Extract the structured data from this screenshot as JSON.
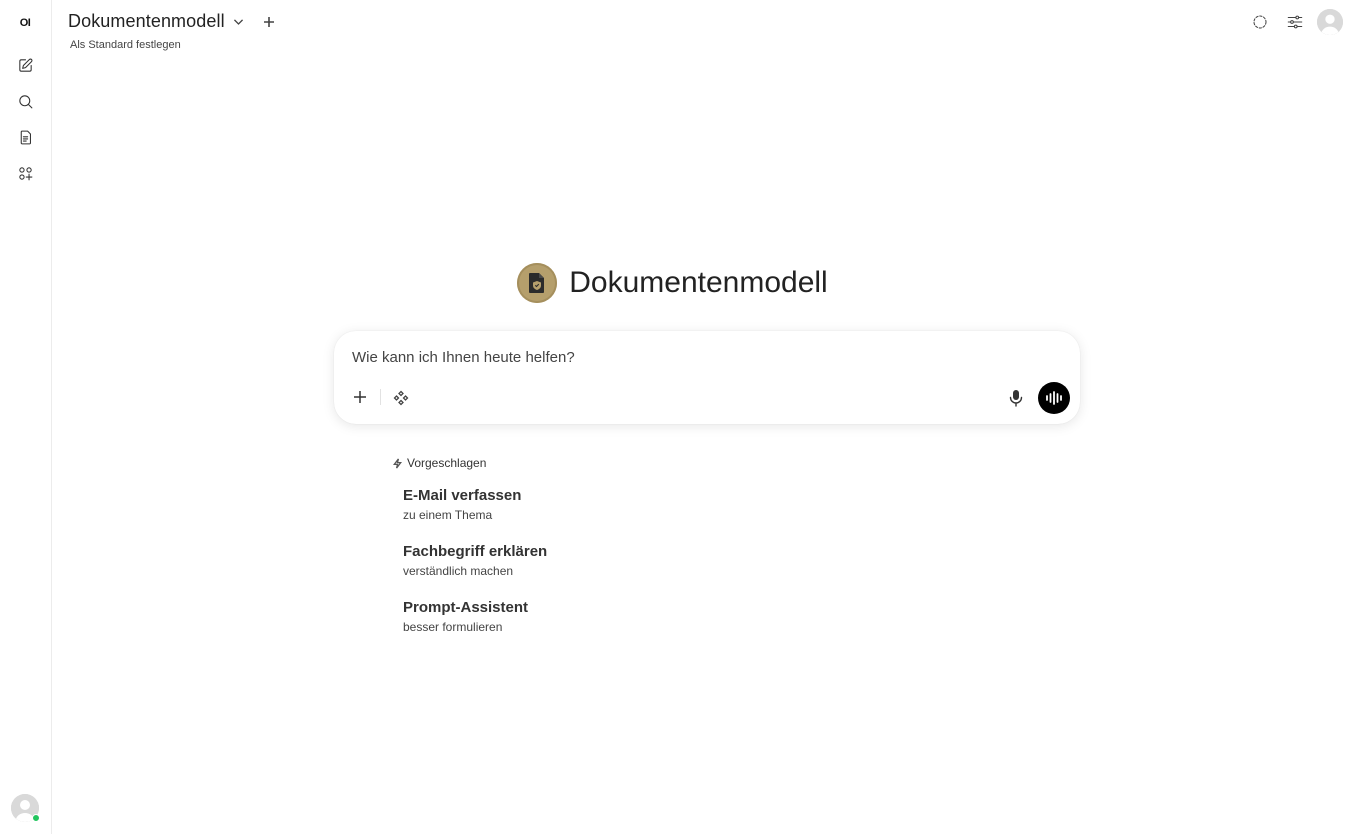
{
  "sidebar": {
    "logo": "OI",
    "items": [
      {
        "name": "new-chat",
        "icon": "pencil-square-icon"
      },
      {
        "name": "search",
        "icon": "search-icon"
      },
      {
        "name": "notes",
        "icon": "document-icon"
      },
      {
        "name": "workspace",
        "icon": "apps-grid-icon"
      }
    ],
    "user_status": "online"
  },
  "header": {
    "model_name": "Dokumentenmodell",
    "set_default": "Als Standard festlegen",
    "right_icons": [
      "temporary-chat-icon",
      "controls-sliders-icon",
      "user-avatar-icon"
    ]
  },
  "hero": {
    "title": "Dokumentenmodell",
    "logo_color": "#b59f6c"
  },
  "chat": {
    "placeholder": "Wie kann ich Ihnen heute helfen?"
  },
  "suggestions": {
    "heading": "Vorgeschlagen",
    "items": [
      {
        "title": "E-Mail verfassen",
        "subtitle": "zu einem Thema"
      },
      {
        "title": "Fachbegriff erklären",
        "subtitle": "verständlich machen"
      },
      {
        "title": "Prompt-Assistent",
        "subtitle": "besser formulieren"
      }
    ]
  }
}
